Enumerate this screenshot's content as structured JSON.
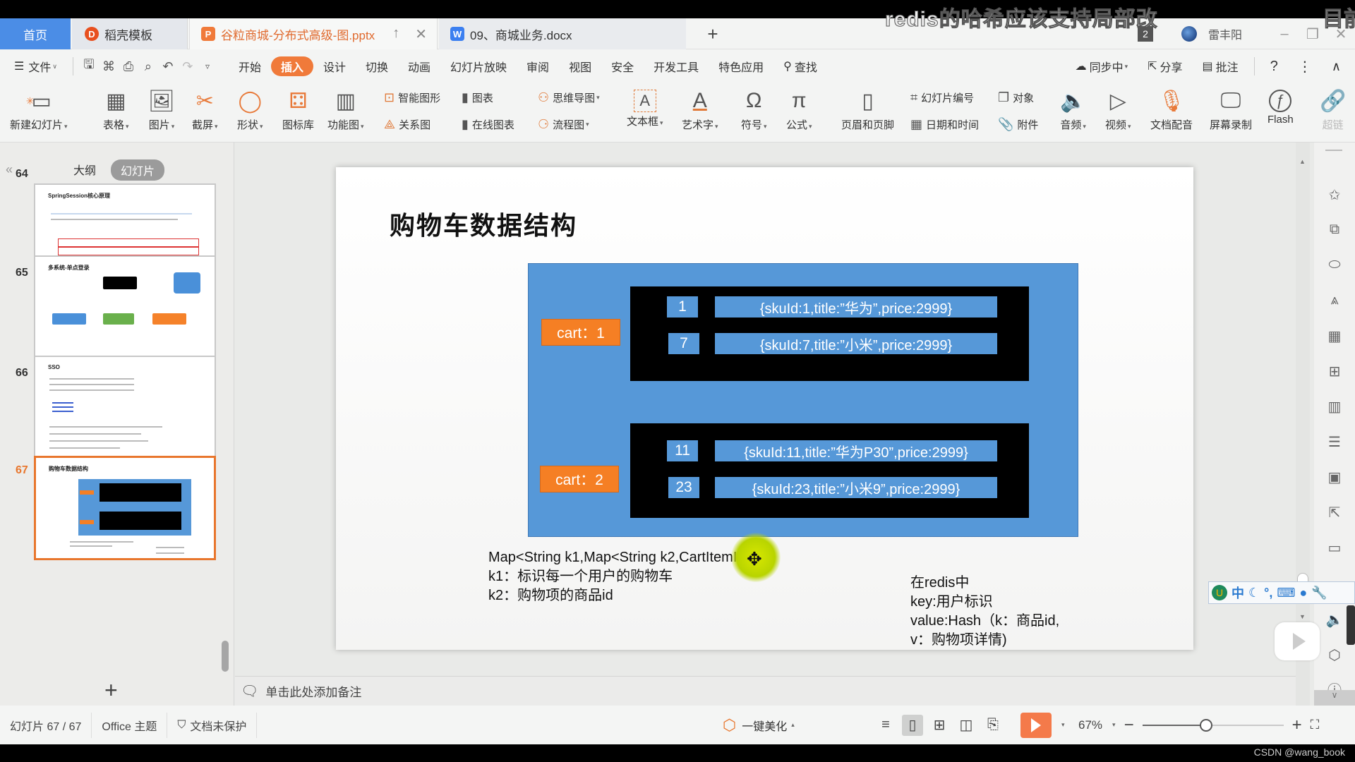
{
  "overlay": {
    "subtitle": "redis的哈希应该支持局部改",
    "subtitle_right": "目前"
  },
  "tabs": [
    {
      "label": "首页",
      "active": false
    },
    {
      "label": "稻壳模板",
      "icon": "docer-icon"
    },
    {
      "label": "谷粒商城-分布式高级-图.pptx",
      "icon": "presentation-icon",
      "active": true
    },
    {
      "label": "09、商城业务.docx",
      "icon": "word-document-icon"
    }
  ],
  "tab_add": "+",
  "window": {
    "badge_count": "2",
    "username": "雷丰阳"
  },
  "menu": {
    "file": "文件",
    "items": [
      "开始",
      "插入",
      "设计",
      "切换",
      "动画",
      "幻灯片放映",
      "审阅",
      "视图",
      "安全",
      "开发工具",
      "特色应用"
    ],
    "active": "插入",
    "search": "查找",
    "sync": "同步中",
    "share": "分享",
    "comment": "批注"
  },
  "ribbon": {
    "new_slide": "新建幻灯片",
    "table": "表格",
    "picture": "图片",
    "screenshot": "截屏",
    "shape": "形状",
    "icon_library": "图标库",
    "function_chart": "功能图",
    "smart_shape": "智能图形",
    "chart": "图表",
    "relation_chart": "关系图",
    "online_chart": "在线图表",
    "mind_map": "思维导图",
    "flow_chart": "流程图",
    "text_box": "文本框",
    "word_art": "艺术字",
    "symbol": "符号",
    "formula": "公式",
    "header_footer": "页眉和页脚",
    "slide_number": "幻灯片编号",
    "object": "对象",
    "date_time": "日期和时间",
    "attachment": "附件",
    "audio": "音频",
    "video": "视频",
    "doc_dubbing": "文档配音",
    "screen_record": "屏幕录制",
    "flash": "Flash",
    "hyperlink": "超链"
  },
  "panel": {
    "outline_tab": "大纲",
    "slides_tab": "幻灯片",
    "thumbnails": [
      {
        "number": "64",
        "title": "SpringSession核心原理"
      },
      {
        "number": "65",
        "title": "多系统-单点登录"
      },
      {
        "number": "66",
        "title": "SSO"
      },
      {
        "number": "67",
        "title": "购物车数据结构",
        "current": true
      }
    ]
  },
  "slide": {
    "title": "购物车数据结构",
    "carts": [
      {
        "label": "cart：1",
        "items": [
          {
            "key": "1",
            "value": "{skuId:1,title:”华为”,price:2999}"
          },
          {
            "key": "7",
            "value": "{skuId:7,title:”小米”,price:2999}"
          }
        ]
      },
      {
        "label": "cart：2",
        "items": [
          {
            "key": "11",
            "value": "{skuId:11,title:”华为P30”,price:2999}"
          },
          {
            "key": "23",
            "value": "{skuId:23,title:”小米9”,price:2999}"
          }
        ]
      }
    ],
    "notes_left": [
      "Map<String k1,Map<String k2,CartItemInfo>>",
      "k1：标识每一个用户的购物车",
      "k2：购物项的商品id"
    ],
    "notes_right": [
      "在redis中",
      "key:用户标识",
      "value:Hash（k：商品id,",
      "v：购物项详情)"
    ]
  },
  "notes_placeholder": "单击此处添加备注",
  "status": {
    "slide_counter": "幻灯片 67 / 67",
    "theme": "Office 主题",
    "protection": "文档未保护",
    "beautify": "一键美化",
    "zoom": "67%",
    "zoom_fraction": 0.45
  },
  "ime": {
    "mode": "中"
  },
  "watermark": "CSDN @wang_book",
  "colors": {
    "accent": "#f07a3a",
    "home_tab": "#4b8de6",
    "diagram_blue": "#5698d8",
    "cart_orange": "#f57f24"
  }
}
